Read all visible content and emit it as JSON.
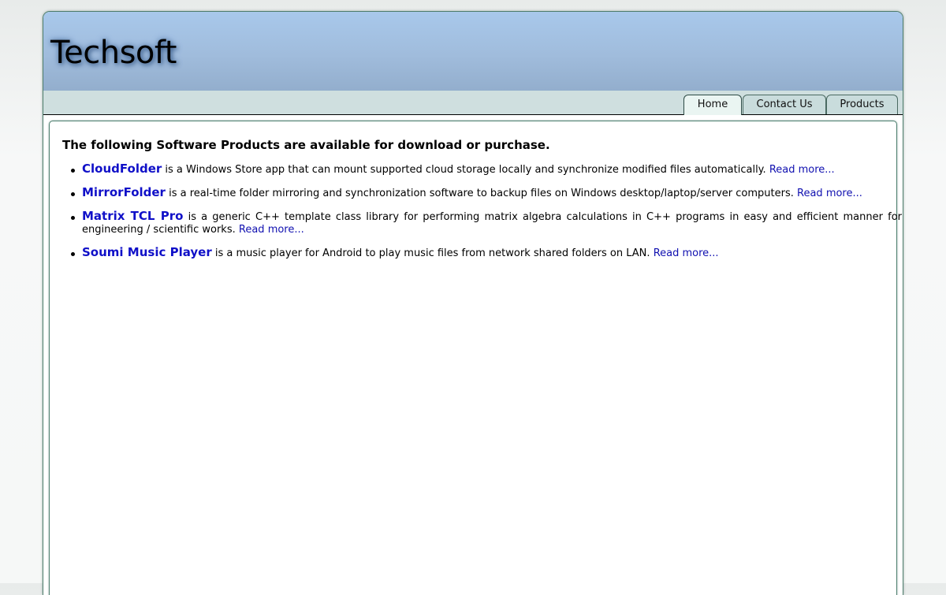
{
  "site": {
    "title": "Techsoft"
  },
  "nav": {
    "tabs": [
      {
        "label": "Home",
        "active": true
      },
      {
        "label": "Contact Us",
        "active": false
      },
      {
        "label": "Products",
        "active": false
      }
    ]
  },
  "main": {
    "intro": "The following Software Products are available for download or purchase.",
    "products": [
      {
        "name": "CloudFolder",
        "description": "is a Windows Store app that can mount supported cloud storage locally and synchronize modified files automatically.",
        "link": "Read more..."
      },
      {
        "name": "MirrorFolder",
        "description": "is a real-time folder mirroring and synchronization software to backup files on Windows desktop/laptop/server computers.",
        "link": "Read more..."
      },
      {
        "name": "Matrix TCL Pro",
        "description": "is a generic C++ template class library for performing matrix algebra calculations in C++ programs in easy and efficient manner for engineering / scientific works.",
        "link": "Read more..."
      },
      {
        "name": "Soumi Music Player",
        "description": "is a music player for Android to play music files from network shared folders on LAN.",
        "link": "Read more..."
      }
    ]
  },
  "colors": {
    "header_top": "#a8c8eb",
    "header_bottom": "#93aecd",
    "tabbar": "#cfdfdf",
    "active_tab": "#eaf5f2",
    "link": "#1010c8",
    "frame_border": "#4e7d6c"
  }
}
